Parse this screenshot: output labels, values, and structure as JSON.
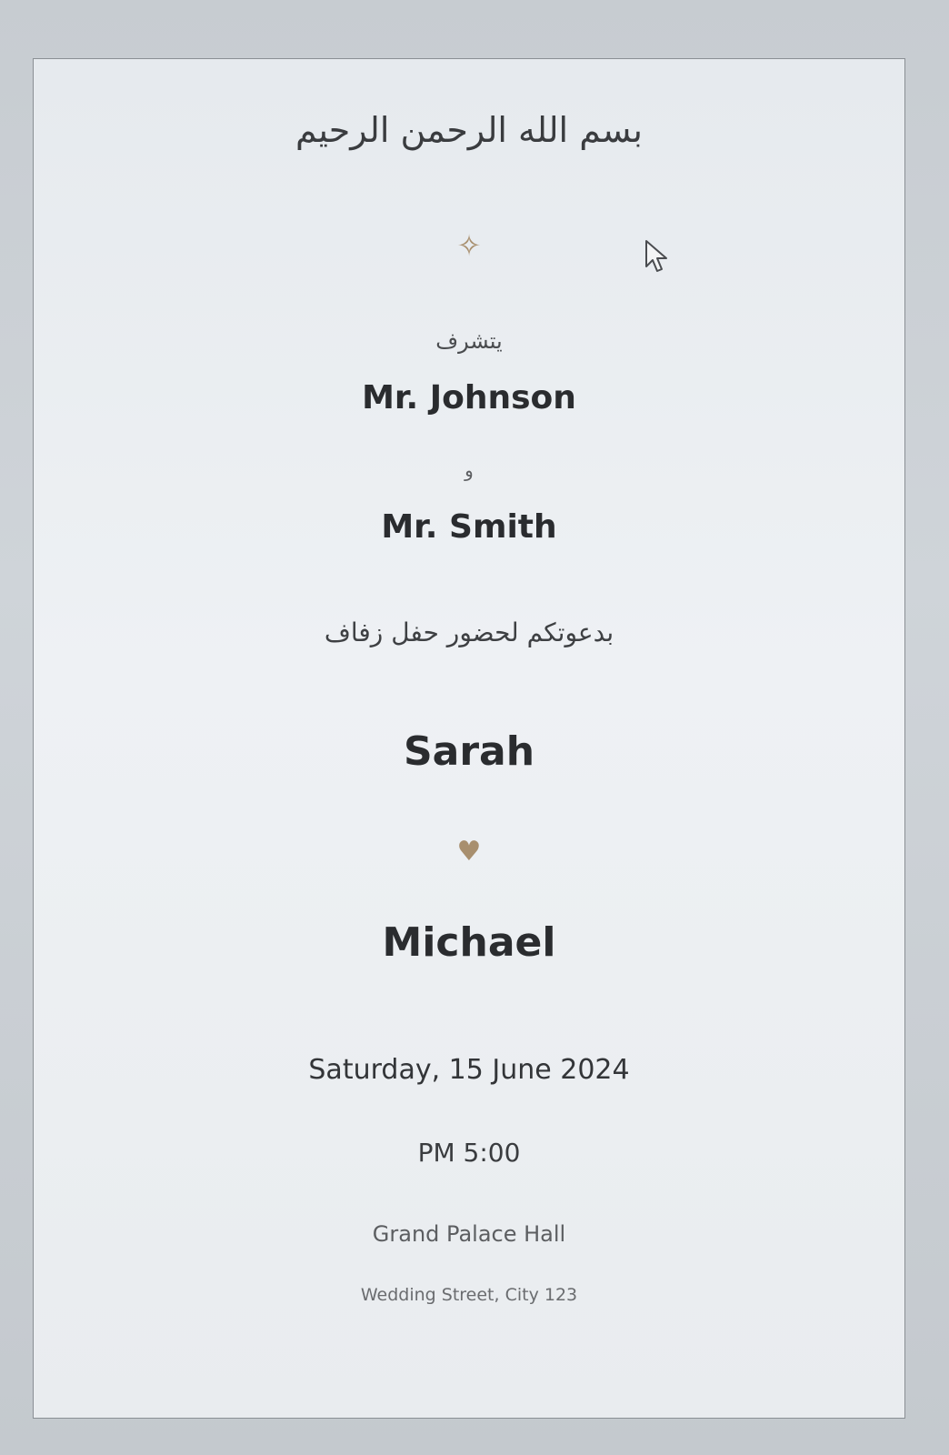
{
  "invitation": {
    "basmala": "بسم الله الرحمن الرحيم",
    "ornament": "✧",
    "honor_text": "يتشرف",
    "host_1": "Mr. Johnson",
    "conjunction": "و",
    "host_2": "Mr. Smith",
    "invite_text": "بدعوتكم لحضور حفل زفاف",
    "bride": "Sarah",
    "heart": "♥",
    "groom": "Michael",
    "date": "Saturday, 15 June 2024",
    "time": "PM 5:00",
    "venue": "Grand Palace Hall",
    "address": "Wedding Street, City 123"
  },
  "colors": {
    "accent_gold": "#a88f6e",
    "text_dark": "#2a2c2f",
    "card_bg": "#eef1f4"
  },
  "icons": {
    "ornament": "sparkle-icon",
    "heart": "heart-icon",
    "cursor": "mouse-cursor-icon"
  }
}
